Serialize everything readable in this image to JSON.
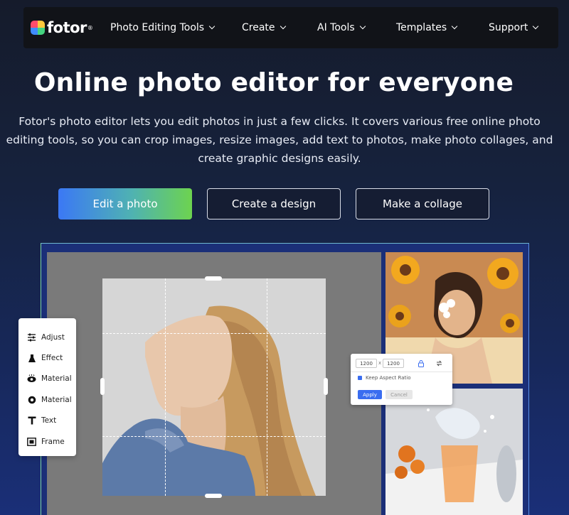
{
  "brand": {
    "name": "fotor",
    "reg": "®"
  },
  "nav": {
    "items": [
      {
        "label": "Photo Editing Tools"
      },
      {
        "label": "Create"
      },
      {
        "label": "AI Tools"
      },
      {
        "label": "Templates"
      },
      {
        "label": "Support"
      }
    ]
  },
  "hero": {
    "title": "Online photo editor for everyone",
    "subtitle": "Fotor's photo editor lets you edit photos in just a few clicks. It covers various free online photo editing tools, so you can crop images, resize images, add text to photos, make photo collages, and create graphic designs easily.",
    "buttons": {
      "edit": "Edit a photo",
      "design": "Create a design",
      "collage": "Make a collage"
    }
  },
  "tools_panel": {
    "items": [
      {
        "label": "Adjust",
        "icon": "sliders-icon"
      },
      {
        "label": "Effect",
        "icon": "flask-icon"
      },
      {
        "label": "Material",
        "icon": "eye-icon"
      },
      {
        "label": "Material",
        "icon": "circle-icon"
      },
      {
        "label": "Text",
        "icon": "text-icon"
      },
      {
        "label": "Frame",
        "icon": "frame-icon"
      }
    ]
  },
  "resize_popup": {
    "width": "1200",
    "sep": "x",
    "height": "1200",
    "keep_aspect": "Keep Aspect Ratio",
    "apply": "Apply",
    "cancel": "Cancel"
  },
  "colors": {
    "accent_blue": "#3a6df0",
    "accent_green": "#6dd34f",
    "nav_bg": "#111318"
  }
}
